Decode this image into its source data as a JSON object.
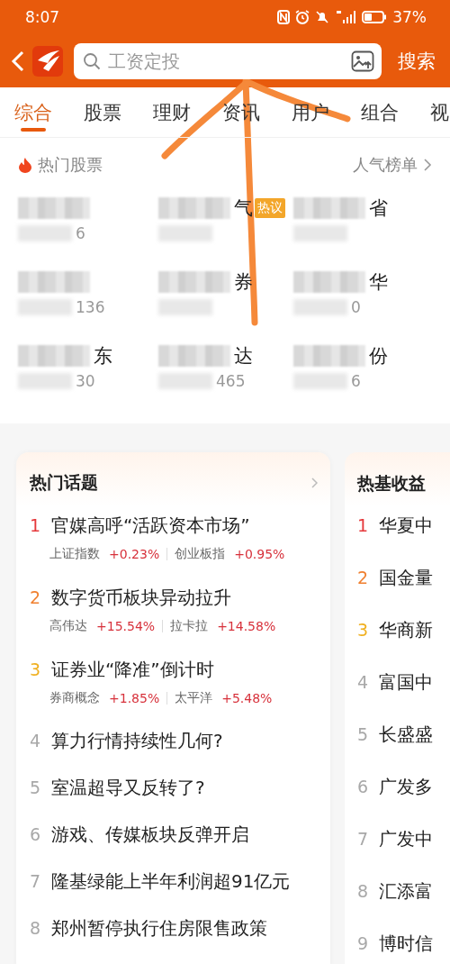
{
  "status_bar": {
    "time": "8:07",
    "battery": "37%"
  },
  "header": {
    "search": {
      "placeholder": "工资定投"
    },
    "search_button": "搜索"
  },
  "tabs": [
    {
      "label": "综合",
      "selected": true
    },
    {
      "label": "股票",
      "selected": false
    },
    {
      "label": "理财",
      "selected": false
    },
    {
      "label": "资讯",
      "selected": false
    },
    {
      "label": "用户",
      "selected": false
    },
    {
      "label": "组合",
      "selected": false
    },
    {
      "label": "视",
      "selected": false
    }
  ],
  "hot_stocks": {
    "title": "热门股票",
    "link": "人气榜单",
    "stocks": [
      {
        "code": "6"
      },
      {
        "name": "气",
        "badge": "热议"
      },
      {
        "name": "省"
      },
      {
        "code": "136"
      },
      {
        "name": "券"
      },
      {
        "name": "华",
        "code": "0"
      },
      {
        "name": "东",
        "code": "30"
      },
      {
        "name": "达",
        "code": "465"
      },
      {
        "name": "份",
        "code": "6"
      }
    ]
  },
  "hot_topics": {
    "title": "热门话题",
    "items": [
      {
        "rank": "1",
        "color": "#e5383b",
        "title": "官媒高呼“活跃资本市场”",
        "tags": [
          {
            "name": "上证指数",
            "change": "+0.23%"
          },
          {
            "name": "创业板指",
            "change": "+0.95%"
          }
        ]
      },
      {
        "rank": "2",
        "color": "#f08030",
        "title": "数字货币板块异动拉升",
        "tags": [
          {
            "name": "高伟达",
            "change": "+15.54%"
          },
          {
            "name": "拉卡拉",
            "change": "+14.58%"
          }
        ]
      },
      {
        "rank": "3",
        "color": "#f0b020",
        "title": "证券业“降准”倒计时",
        "tags": [
          {
            "name": "券商概念",
            "change": "+1.85%"
          },
          {
            "name": "太平洋",
            "change": "+5.48%"
          }
        ]
      },
      {
        "rank": "4",
        "color": "#a8a8a8",
        "title": "算力行情持续性几何?"
      },
      {
        "rank": "5",
        "color": "#a8a8a8",
        "title": "室温超导又反转了?"
      },
      {
        "rank": "6",
        "color": "#a8a8a8",
        "title": "游戏、传媒板块反弹开启"
      },
      {
        "rank": "7",
        "color": "#a8a8a8",
        "title": "隆基绿能上半年利润超91亿元"
      },
      {
        "rank": "8",
        "color": "#a8a8a8",
        "title": "郑州暂停执行住房限售政策"
      }
    ]
  },
  "hot_funds": {
    "title": "热基收益",
    "items": [
      {
        "rank": "1",
        "color": "#e5383b",
        "name": "华夏中"
      },
      {
        "rank": "2",
        "color": "#f08030",
        "name": "国金量"
      },
      {
        "rank": "3",
        "color": "#f0b020",
        "name": "华商新"
      },
      {
        "rank": "4",
        "color": "#a8a8a8",
        "name": "富国中"
      },
      {
        "rank": "5",
        "color": "#a8a8a8",
        "name": "长盛盛"
      },
      {
        "rank": "6",
        "color": "#a8a8a8",
        "name": "广发多"
      },
      {
        "rank": "7",
        "color": "#a8a8a8",
        "name": "广发中"
      },
      {
        "rank": "8",
        "color": "#a8a8a8",
        "name": "汇添富"
      },
      {
        "rank": "9",
        "color": "#a8a8a8",
        "name": "博时信"
      }
    ]
  }
}
